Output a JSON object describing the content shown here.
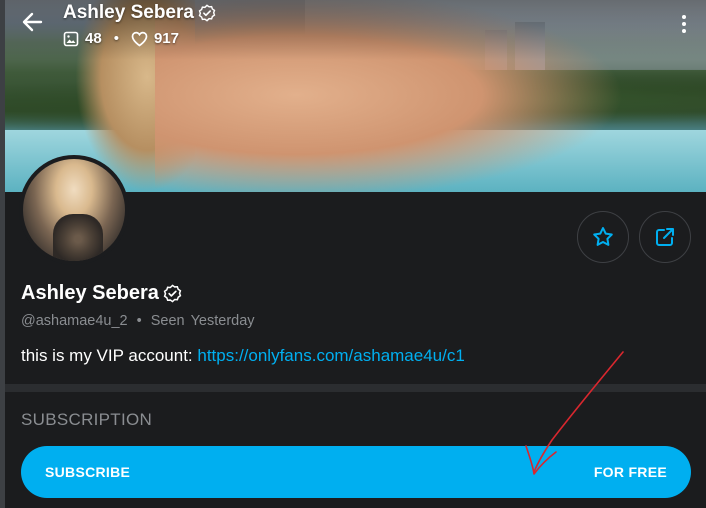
{
  "header": {
    "name": "Ashley Sebera",
    "media_count": "48",
    "likes_count": "917",
    "separator": "•"
  },
  "profile": {
    "name": "Ashley Sebera",
    "handle": "@ashamae4u_2",
    "meta_separator": "•",
    "seen_label": "Seen",
    "seen_value": "Yesterday",
    "bio_text": "this is my VIP account: ",
    "bio_link": "https://onlyfans.com/ashamae4u/c1"
  },
  "subscription": {
    "section_label": "SUBSCRIPTION",
    "button_left": "SUBSCRIBE",
    "button_right": "FOR FREE"
  },
  "colors": {
    "accent": "#00aff0",
    "background": "#1b1c1e",
    "muted_text": "#8a8d91",
    "annotation_arrow": "#d9272e"
  },
  "icons": [
    "back-arrow-icon",
    "verified-badge-icon",
    "image-icon",
    "heart-icon",
    "more-vertical-icon",
    "star-icon",
    "share-icon"
  ]
}
